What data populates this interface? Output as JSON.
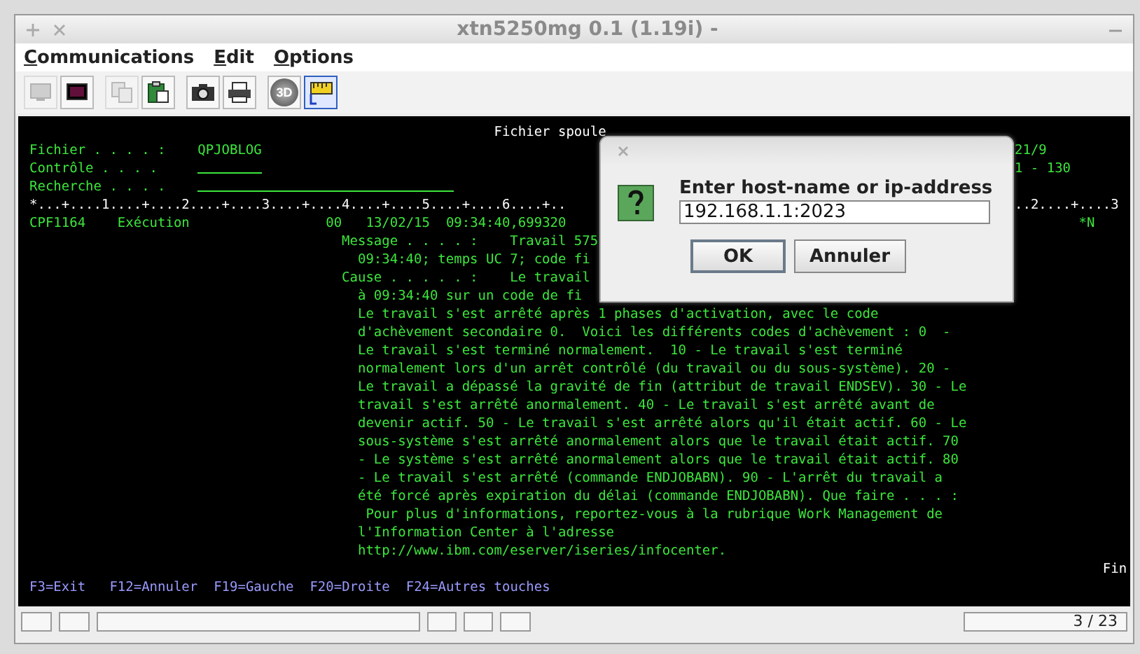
{
  "window": {
    "title": "xtn5250mg 0.1 (1.19i) -"
  },
  "menu": [
    "Communications",
    "Edit",
    "Options"
  ],
  "toolbar": {
    "groups": [
      [
        {
          "kind": "display",
          "disabled": true,
          "on": false
        },
        {
          "kind": "screen",
          "disabled": false,
          "on": false
        }
      ],
      [
        {
          "kind": "copy",
          "disabled": true,
          "on": false
        },
        {
          "kind": "paste",
          "disabled": false,
          "on": false
        }
      ],
      [
        {
          "kind": "camera",
          "disabled": false,
          "on": false
        },
        {
          "kind": "print",
          "disabled": false,
          "on": false
        }
      ],
      [
        {
          "kind": "sphere",
          "label": "3D",
          "disabled": false,
          "on": false
        },
        {
          "kind": "ruler",
          "disabled": false,
          "on": true
        }
      ]
    ]
  },
  "terminal": {
    "title": "Fichier spoule",
    "fields": [
      {
        "label": "Fichier . . . . :",
        "kind": "value",
        "value": "QPJOBLOG",
        "right": "21/9"
      },
      {
        "label": "Contrôle . . . .",
        "kind": "input",
        "right": "1 - 130"
      },
      {
        "label": "Recherche . . . .",
        "kind": "input"
      }
    ],
    "ruler": {
      "left": "*...+....1....+....2....+....3....+....4....+....5....+....6....+..",
      "right": "..2....+....3"
    },
    "entry": {
      "message_id": "CPF1164",
      "type": "Exécution",
      "severity": "00",
      "date": "13/02/15",
      "time": "09:34:40,699320",
      "flag": "*N"
    },
    "details": [
      {
        "kind": "label",
        "label": "Message . . . . :",
        "text": "Travail 575"
      },
      {
        "kind": "cont",
        "text": "09:34:40; temps UC 7; code fi"
      },
      {
        "kind": "label",
        "label": "Cause . . . . . :",
        "text": "Le travail"
      },
      {
        "kind": "cont",
        "text": "à 09:34:40 sur un code de fi"
      },
      {
        "kind": "cont",
        "text": "Le travail s'est arrêté après 1 phases d'activation, avec le code"
      },
      {
        "kind": "cont",
        "text": "d'achèvement secondaire 0.  Voici les différents codes d'achèvement : 0  -"
      },
      {
        "kind": "cont",
        "text": "Le travail s'est terminé normalement.  10 - Le travail s'est terminé"
      },
      {
        "kind": "cont",
        "text": "normalement lors d'un arrêt contrôlé (du travail ou du sous-système). 20 -"
      },
      {
        "kind": "cont",
        "text": "Le travail a dépassé la gravité de fin (attribut de travail ENDSEV). 30 - Le"
      },
      {
        "kind": "cont",
        "text": "travail s'est arrêté anormalement. 40 - Le travail s'est arrêté avant de"
      },
      {
        "kind": "cont",
        "text": "devenir actif. 50 - Le travail s'est arrêté alors qu'il était actif. 60 - Le"
      },
      {
        "kind": "cont",
        "text": "sous-système s'est arrêté anormalement alors que le travail était actif. 70"
      },
      {
        "kind": "cont",
        "text": "- Le système s'est arrêté anormalement alors que le travail était actif. 80"
      },
      {
        "kind": "cont",
        "text": "- Le travail s'est arrêté (commande ENDJOBABN). 90 - L'arrêt du travail a"
      },
      {
        "kind": "cont",
        "text": "été forcé après expiration du délai (commande ENDJOBABN). Que faire . . . :"
      },
      {
        "kind": "indent",
        "text": "Pour plus d'informations, reportez-vous à la rubrique Work Management de"
      },
      {
        "kind": "cont",
        "text": "l'Information Center à l'adresse"
      },
      {
        "kind": "cont",
        "text": "http://www.ibm.com/eserver/iseries/infocenter."
      }
    ],
    "more": "Fin",
    "function_keys": [
      "F3=Exit",
      "F12=Annuler",
      "F19=Gauche",
      "F20=Droite",
      "F24=Autres touches"
    ]
  },
  "dialog": {
    "label": "Enter host-name or ip-address",
    "value": "192.168.1.1:2023",
    "buttons": [
      "OK",
      "Annuler"
    ]
  },
  "status_bar": {
    "position": "3 / 23"
  }
}
